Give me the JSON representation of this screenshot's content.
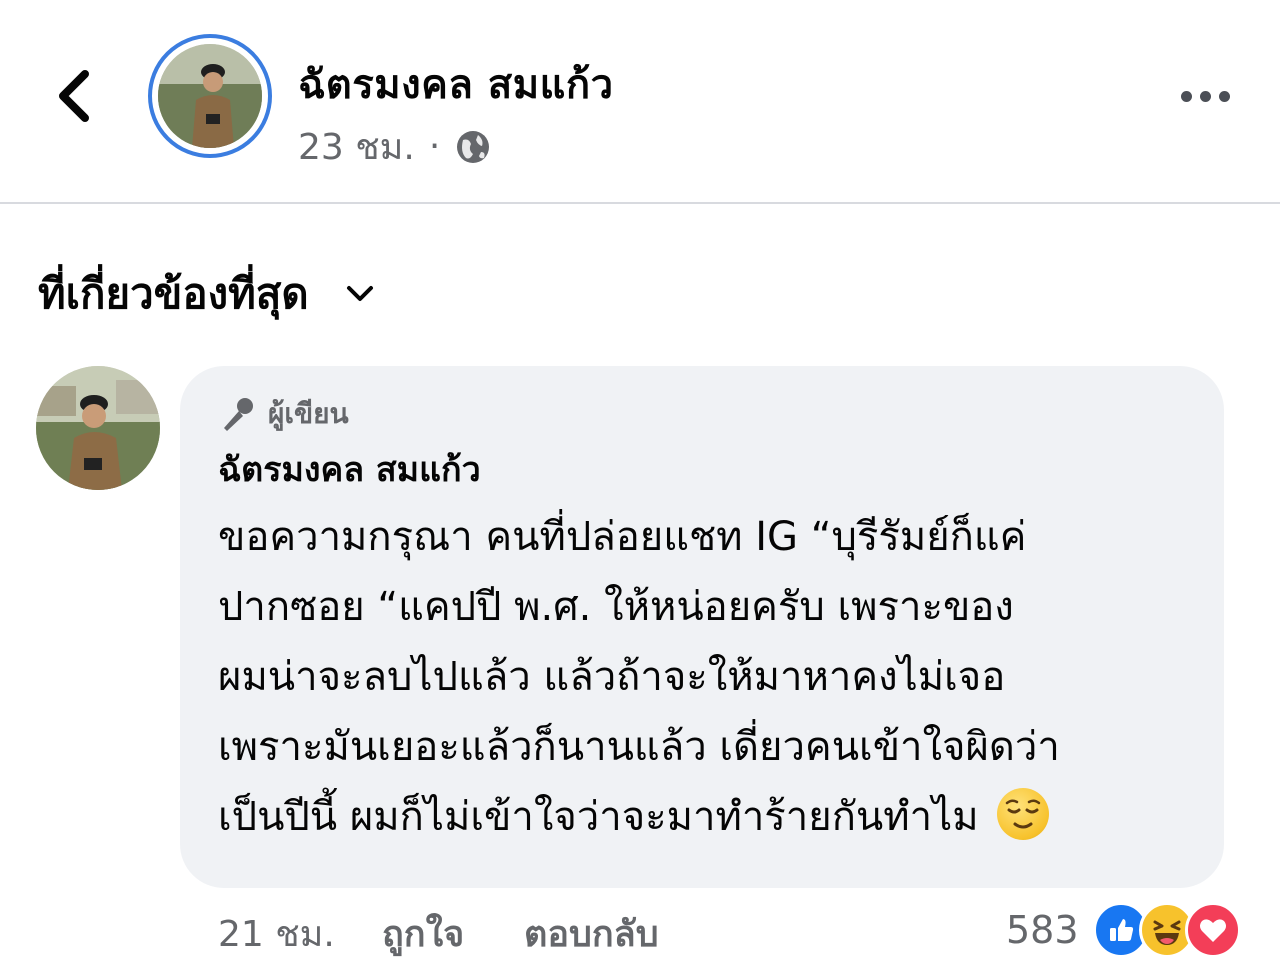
{
  "header": {
    "author_name": "ฉัตรมงคล สมแก้ว",
    "time": "23 ชม.",
    "separator": "·"
  },
  "sort": {
    "label": "ที่เกี่ยวข้องที่สุด"
  },
  "comment": {
    "badge": "ผู้เขียน",
    "name": "ฉัตรมงคล สมแก้ว",
    "lines": [
      "ขอความกรุณา คนที่ปล่อยแชท IG “บุรีรัมย์ก็แค่",
      "ปากซอย “แคปปี พ.ศ. ให้หน่อยครับ เพราะของ",
      "ผมน่าจะลบไปแล้ว แล้วถ้าจะให้มาหาคงไม่เจอ",
      "เพราะมันเยอะแล้วก็นานแล้ว เดี่ยวคนเข้าใจผิดว่า",
      "เป็นปีนี้ ผมก็ไม่เข้าใจว่าจะมาทำร้ายกันทำไม"
    ],
    "time": "21 ชม.",
    "like_label": "ถูกใจ",
    "reply_label": "ตอบกลับ",
    "reaction_count": "583",
    "reactions": [
      "like-reaction",
      "haha-reaction",
      "love-reaction"
    ]
  },
  "colors": {
    "accent": "#3b7de0",
    "bubble": "#f0f2f5",
    "secondary_text": "#65676b",
    "like": "#1877f2",
    "love": "#f33e58",
    "haha": "#f7c22c"
  }
}
